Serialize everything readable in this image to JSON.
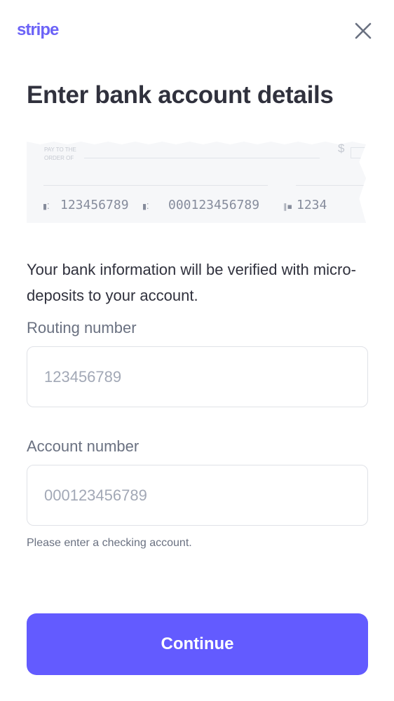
{
  "brand": {
    "logo": "stripe",
    "color": "#635bff"
  },
  "header": {
    "close_icon": "close-icon"
  },
  "title": "Enter bank account details",
  "check": {
    "pay_to": "PAY TO THE",
    "order_of": "ORDER OF",
    "dollar": "$",
    "routing": "123456789",
    "account": "000123456789",
    "check_number": "1234"
  },
  "info": "Your bank information will be verified with micro-deposits to your account.",
  "routing": {
    "label": "Routing number",
    "placeholder": "123456789",
    "value": ""
  },
  "account": {
    "label": "Account number",
    "placeholder": "000123456789",
    "value": "",
    "hint": "Please enter a checking account."
  },
  "continue_label": "Continue"
}
